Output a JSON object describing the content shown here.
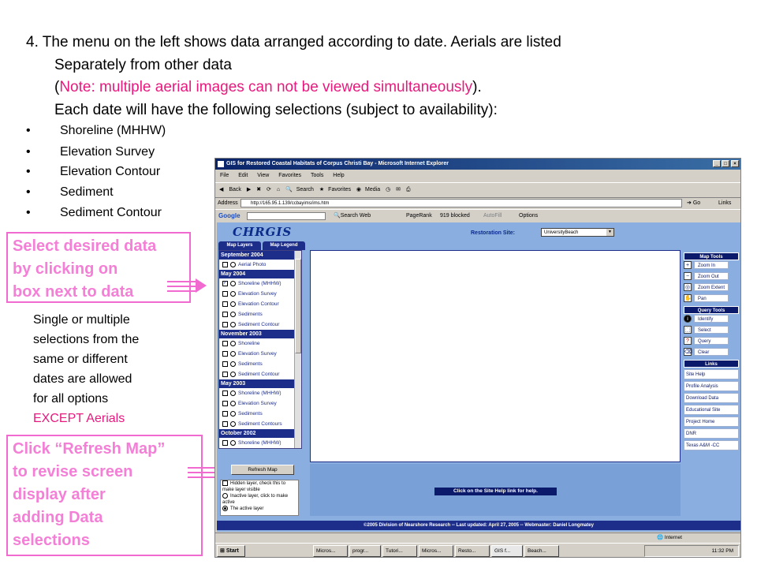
{
  "slide": {
    "para_line1": "4.  The menu on the left shows data arranged according to date.  Aerials are listed",
    "para_line2": "Separately from other data",
    "para_line3_open": "(",
    "para_line3_note": "Note: multiple aerial images can not be viewed simultaneously",
    "para_line3_close": ").",
    "para_line4": "Each date will have the following selections (subject to availability):",
    "bullet_char": "•",
    "bullets": [
      "Shoreline (MHHW)",
      "Elevation Survey",
      "Elevation Contour",
      "Sediment",
      "Sediment Contour"
    ],
    "callout1_line1": "Select desired data",
    "callout1_line2": "by clicking on",
    "callout1_line3": "box next to data",
    "note_line1": "Single or multiple",
    "note_line2": "selections from the",
    "note_line3": "same or different",
    "note_line4": "dates are allowed",
    "note_line5": "for all options",
    "note_line6": "EXCEPT Aerials",
    "callout2_line1": "Click “Refresh Map”",
    "callout2_line2": "to revise screen",
    "callout2_line3": "display  after",
    "callout2_line4": "adding Data",
    "callout2_line5": "selections",
    "accent_color": "#e8197d",
    "callout_color": "#f47fd6"
  },
  "browser": {
    "title": "GIS for Restored Coastal Habitats of Corpus Christi Bay - Microsoft Internet Explorer",
    "menu": [
      "File",
      "Edit",
      "View",
      "Favorites",
      "Tools",
      "Help"
    ],
    "toolbar": [
      "Back",
      "Search",
      "Favorites",
      "Media"
    ],
    "address_label": "Address",
    "address": "http://165.95.1.139/ccbayims/ims.htm",
    "go_label": "Go",
    "links_label": "Links",
    "google_label": "Google",
    "search_web": "Search Web",
    "pagerank": "PageRank",
    "blocked": "919 blocked",
    "autofill": "AutoFill",
    "options": "Options",
    "logo": "CHRGIS",
    "restoration_label": "Restoration Site:",
    "restoration_value": "UniversityBeach",
    "tab_layers": "Map Layers",
    "tab_legend": "Map Legend",
    "groups": [
      {
        "date": "September 2004",
        "items": [
          "Aerial Photo"
        ]
      },
      {
        "date": "May 2004",
        "items": [
          "Shoreline (MHHW)",
          "Elevation Survey",
          "Elevation Contour",
          "Sediments",
          "Sediment Contour"
        ]
      },
      {
        "date": "November 2003",
        "items": [
          "Shoreline",
          "Elevation Survey",
          "Sediments",
          "Sediment Contour"
        ]
      },
      {
        "date": "May 2003",
        "items": [
          "Shoreline (MHHW)",
          "Elevation Survey",
          "Sediments",
          "Sediment Contours"
        ]
      },
      {
        "date": "October 2002",
        "items": [
          "Shoreline (MHHW)"
        ]
      }
    ],
    "refresh_button": "Refresh Map",
    "legend_hidden": "Hidden layer, check this to make layer visible",
    "legend_inactive": "Inactive layer, click to make active",
    "legend_active": "The active layer",
    "help_banner": "Click on the Site Help link for help.",
    "footer": "©2005 Division of Nearshore Research  --  Last updated: April 27, 2005  --  Webmaster: Daniel Longmatey",
    "map_tools_header": "Map Tools",
    "map_tools": [
      "Zoom In",
      "Zoom Out",
      "Zoom Extent",
      "Pan"
    ],
    "query_tools_header": "Query Tools",
    "query_tools": [
      "Identify",
      "Select",
      "Query",
      "Clear"
    ],
    "links_header": "Links",
    "links": [
      "Site Help",
      "Profile Analysis",
      "Download Data",
      "Educational Site",
      "Project Home",
      "DNR",
      "Texas A&M -CC"
    ],
    "status_zone": "Internet",
    "start": "Start",
    "tasks": [
      "Micros...",
      "progr...",
      "Tutori...",
      "Micros...",
      "Resto...",
      "GIS f...",
      "Beach..."
    ],
    "clock": "11:32 PM"
  }
}
